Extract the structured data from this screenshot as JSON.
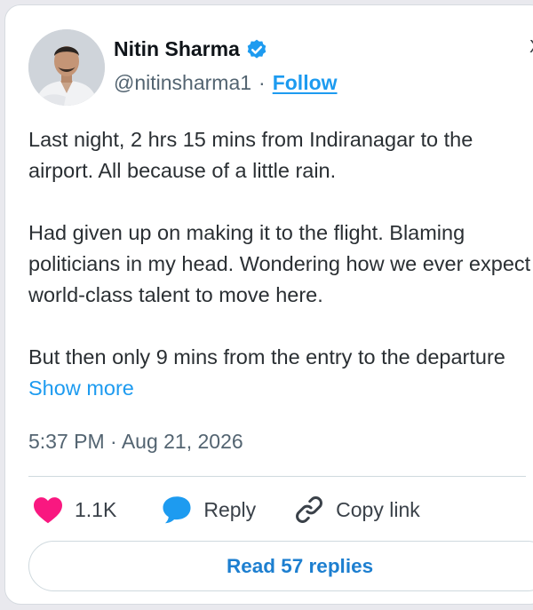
{
  "author": {
    "name": "Nitin Sharma",
    "handle": "@nitinsharma1",
    "separator": "·",
    "follow_label": "Follow",
    "verified": true,
    "avatar_icon": "profile-photo"
  },
  "close_glyph": "X",
  "tweet": {
    "paragraphs": [
      "Last night, 2 hrs 15 mins from Indiranagar to the airport. All because of a little rain.",
      "Had given up on making it to the flight. Blaming politicians in my head. Wondering how we ever expect world-class talent to move here.",
      "But then only 9 mins from the entry to the departure"
    ],
    "show_more_label": "Show more",
    "timestamp": "5:37 PM · Aug 21, 2026"
  },
  "actions": {
    "like_count": "1.1K",
    "like_icon": "heart-icon",
    "reply_label": "Reply",
    "reply_icon": "speech-bubble-icon",
    "copy_label": "Copy link",
    "copy_icon": "link-icon"
  },
  "read_replies_label": "Read 57 replies",
  "colors": {
    "accent": "#1d9bf0",
    "like": "#f91880",
    "text": "#0f1419",
    "muted": "#536471"
  }
}
